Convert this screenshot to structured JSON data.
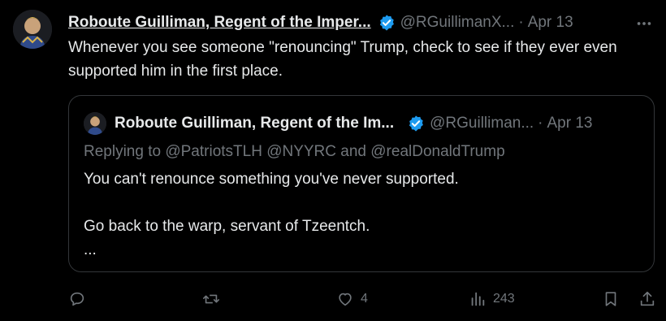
{
  "tweet": {
    "author_name": "Roboute Guilliman, Regent of the Imper...",
    "handle": "@RGuillimanX...",
    "separator": "·",
    "date": "Apr 13",
    "text": "Whenever you see someone \"renouncing\" Trump, check to see if they ever even supported him in the first place."
  },
  "quote": {
    "author_name": "Roboute Guilliman, Regent of the Im...",
    "handle": "@RGuilliman...",
    "separator": "·",
    "date": "Apr 13",
    "replying_to": "Replying to @PatriotsTLH @NYYRC and @realDonaldTrump",
    "text": "You can't renounce something you've never supported.\n\nGo back to the warp, servant of Tzeentch.\n..."
  },
  "actions": {
    "reply_count": "",
    "retweet_count": "",
    "like_count": "4",
    "view_count": "243"
  },
  "colors": {
    "background": "#000000",
    "text": "#e7e9ea",
    "muted": "#71767b",
    "verified": "#1d9bf0",
    "border": "#333639"
  },
  "icons": [
    "more-icon",
    "verified-badge-icon",
    "reply-icon",
    "retweet-icon",
    "like-icon",
    "views-icon",
    "bookmark-icon",
    "share-icon"
  ]
}
